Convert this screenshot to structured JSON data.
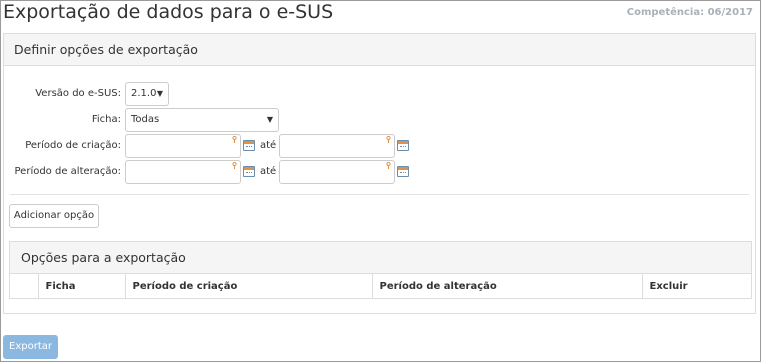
{
  "page": {
    "title": "Exportação de dados para o e-SUS",
    "competencia": "Competência: 06/2017"
  },
  "options_panel": {
    "title": "Definir opções de exportação",
    "versao_label": "Versão do e-SUS:",
    "versao_value": "2.1.0",
    "ficha_label": "Ficha:",
    "ficha_value": "Todas",
    "periodo_criacao_label": "Período de criação:",
    "periodo_alteracao_label": "Período de alteração:",
    "ate_label": "até",
    "add_button": "Adicionar opção"
  },
  "export_options": {
    "title": "Opções para a exportação",
    "columns": [
      "",
      "Ficha",
      "Período de criação",
      "Período de alteração",
      "Excluir"
    ]
  },
  "export_button": "Exportar",
  "colors": {
    "accent_button": "#8bb8e0",
    "muted_text": "#a9b1b8"
  },
  "icons": {
    "calendar": "calendar-icon",
    "select_caret": "caret-down-icon",
    "input_marker": "pin-icon"
  }
}
